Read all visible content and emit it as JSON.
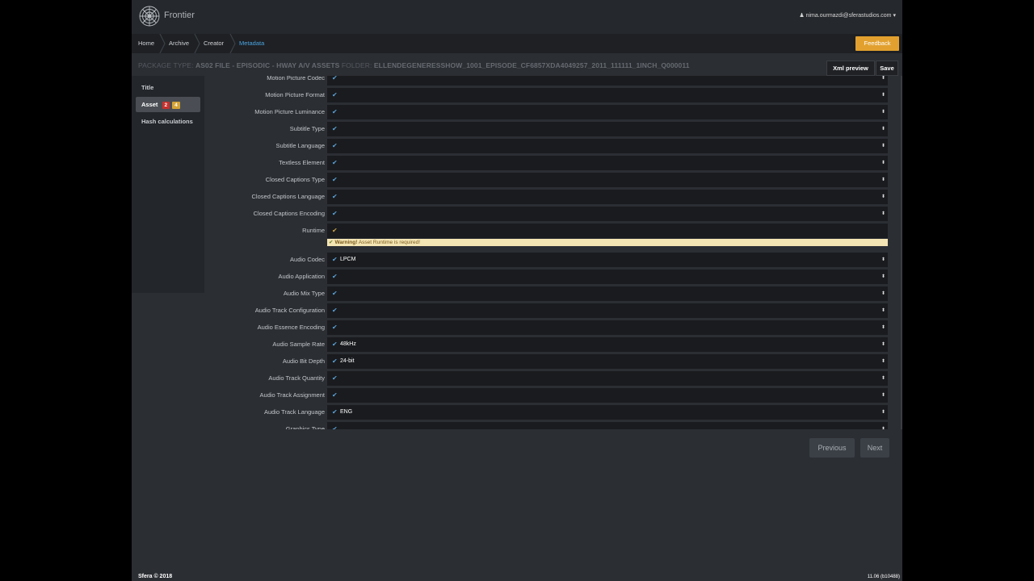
{
  "header": {
    "brand": "Frontier",
    "user": "nima.ourmazdi@sferastudios.com",
    "user_caret": "▾",
    "user_icon": "person-icon"
  },
  "breadcrumb": {
    "items": [
      {
        "label": "Home"
      },
      {
        "label": "Archive"
      },
      {
        "label": "Creator"
      },
      {
        "label": "Metadata"
      }
    ],
    "active_color": "#4aa3df"
  },
  "feedback_label": "Feedback",
  "package": {
    "type_label": "PACKAGE TYPE:",
    "type_value": "AS02 FILE - EPISODIC - HWAY A/V ASSETS",
    "folder_label": "FOLDER:",
    "folder_value": "ELLENDEGENERESSHOW_1001_EPISODE_CF6857XDA4049257_2011_111111_1INCH_Q000011"
  },
  "toolbar": {
    "xml_preview_label": "Xml preview",
    "save_label": "Save"
  },
  "sidebar": {
    "items": [
      {
        "label": "Title"
      },
      {
        "label": "Asset",
        "badge_red": "2",
        "badge_yellow": "4"
      },
      {
        "label": "Hash calculations"
      }
    ]
  },
  "form": {
    "rows": [
      {
        "label": "Motion Picture Codec",
        "value": ""
      },
      {
        "label": "Motion Picture Format",
        "value": ""
      },
      {
        "label": "Motion Picture Luminance",
        "value": ""
      },
      {
        "label": "Subtitle Type",
        "value": ""
      },
      {
        "label": "Subtitle Language",
        "value": ""
      },
      {
        "label": "Textless Element",
        "value": ""
      },
      {
        "label": "Closed Captions Type",
        "value": ""
      },
      {
        "label": "Closed Captions Language",
        "value": ""
      },
      {
        "label": "Closed Captions Encoding",
        "value": ""
      },
      {
        "label": "Runtime",
        "value": ""
      },
      {
        "label": "Audio Codec",
        "value": "LPCM"
      },
      {
        "label": "Audio Application",
        "value": ""
      },
      {
        "label": "Audio Mix Type",
        "value": ""
      },
      {
        "label": "Audio Track Configuration",
        "value": ""
      },
      {
        "label": "Audio Essence Encoding",
        "value": ""
      },
      {
        "label": "Audio Sample Rate",
        "value": "48kHz"
      },
      {
        "label": "Audio Bit Depth",
        "value": "24-bit"
      },
      {
        "label": "Audio Track Quantity",
        "value": ""
      },
      {
        "label": "Audio Track Assignment",
        "value": ""
      },
      {
        "label": "Audio Track Language",
        "value": "ENG"
      },
      {
        "label": "Graphics Type",
        "value": ""
      }
    ],
    "warning": {
      "strong": "Warning!",
      "text": "Asset Runtime is required!"
    },
    "check_glyph": "✔",
    "select_arrows": "⬍"
  },
  "pager": {
    "previous_label": "Previous",
    "next_label": "Next"
  },
  "footer": {
    "copyright": "Sfera © 2018",
    "version": "11.06 (b10488)"
  }
}
